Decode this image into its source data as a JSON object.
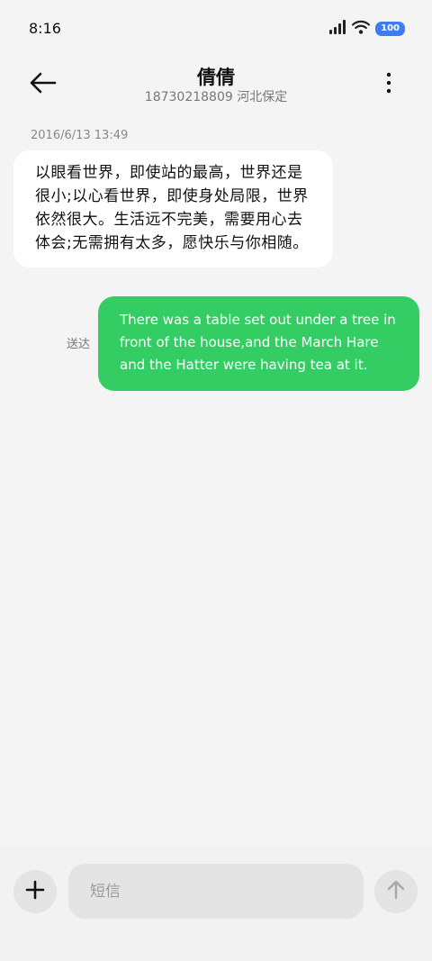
{
  "status_bar": {
    "time": "8:16",
    "battery": "100",
    "icons": [
      "cellular-signal-icon",
      "wifi-icon",
      "battery-icon"
    ]
  },
  "header": {
    "name": "倩倩",
    "subtitle": "18730218809 河北保定",
    "back_icon": "arrow-left-icon",
    "more_icon": "more-vertical-icon"
  },
  "conversation": {
    "timestamp": "2016/6/13 13:49",
    "incoming_message": "以眼看世界，即使站的最高，世界还是很小;以心看世界，即使身处局限，世界依然很大。生活远不完美，需要用心去体会;无需拥有太多，愿快乐与你相随。",
    "outgoing_message": "There was a table set out under a tree in front of the house,and the March Hare and the Hatter were having tea at it.",
    "delivery_status": "送达"
  },
  "composer": {
    "placeholder": "短信",
    "value": "",
    "add_icon": "plus-icon",
    "send_icon": "arrow-up-icon"
  },
  "colors": {
    "background": "#f4f4f4",
    "incoming_bubble": "#ffffff",
    "outgoing_bubble": "#34cd64",
    "battery_badge": "#3d7df0"
  }
}
